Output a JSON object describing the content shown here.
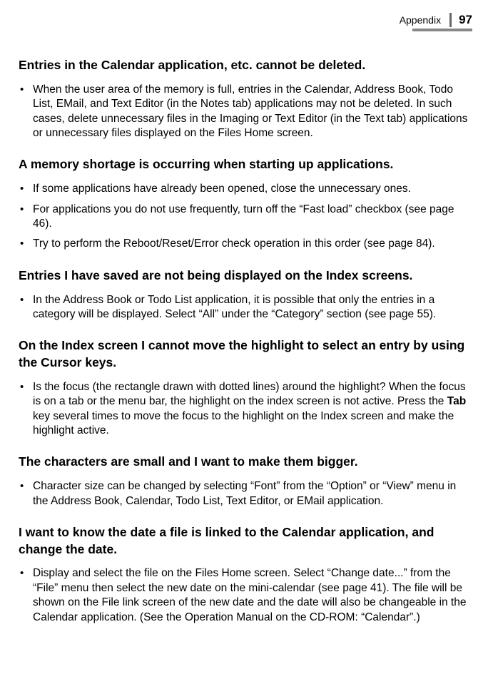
{
  "header": {
    "section": "Appendix",
    "page": "97"
  },
  "sections": [
    {
      "heading": "Entries in the Calendar application, etc. cannot be deleted.",
      "items": [
        "When the user area of the memory is full, entries in the Calendar, Address Book, Todo List, EMail, and Text Editor (in the Notes tab) applications may not be deleted. In such cases, delete unnecessary files in the Imaging or Text Editor (in the Text tab) applications or unnecessary files displayed on the Files Home screen."
      ]
    },
    {
      "heading": "A memory shortage is occurring when starting up applications.",
      "items": [
        "If some applications have already been opened, close the unnecessary ones.",
        "For applications you do not use frequently, turn off the “Fast load” checkbox  (see page 46).",
        "Try to perform the Reboot/Reset/Error check operation in this order (see page 84)."
      ]
    },
    {
      "heading": "Entries I have saved are not being displayed on the Index screens.",
      "items": [
        "In the Address Book or Todo List application, it is possible that only the entries in a category will be displayed. Select “All” under the “Category” section (see page 55)."
      ]
    },
    {
      "heading": "On the Index screen I cannot move the highlight to select an entry by using the Cursor keys.",
      "items_raw": [
        {
          "pre": "Is the focus (the rectangle drawn with dotted lines) around the highlight? When the focus is on a tab or the menu bar, the highlight on the index screen is not active. Press the ",
          "bold": "Tab",
          "post": " key several times to move the focus to the highlight on the Index screen and make the highlight active."
        }
      ]
    },
    {
      "heading": "The characters are small and I want to make them bigger.",
      "items": [
        "Character size can be changed by selecting “Font” from the “Option” or “View” menu in the Address Book, Calendar, Todo List, Text Editor, or EMail application."
      ]
    },
    {
      "heading": "I want to know the date a file is linked to the Calendar application, and change the date.",
      "items": [
        "Display and select the file on the Files Home screen. Select “Change date...” from the “File” menu then select the new date on the mini-calendar (see page 41). The file will be shown on the File link screen of the new date and the date will also be changeable in the Calendar application. (See the Operation Manual on the CD-ROM: “Calendar”.)"
      ]
    }
  ]
}
